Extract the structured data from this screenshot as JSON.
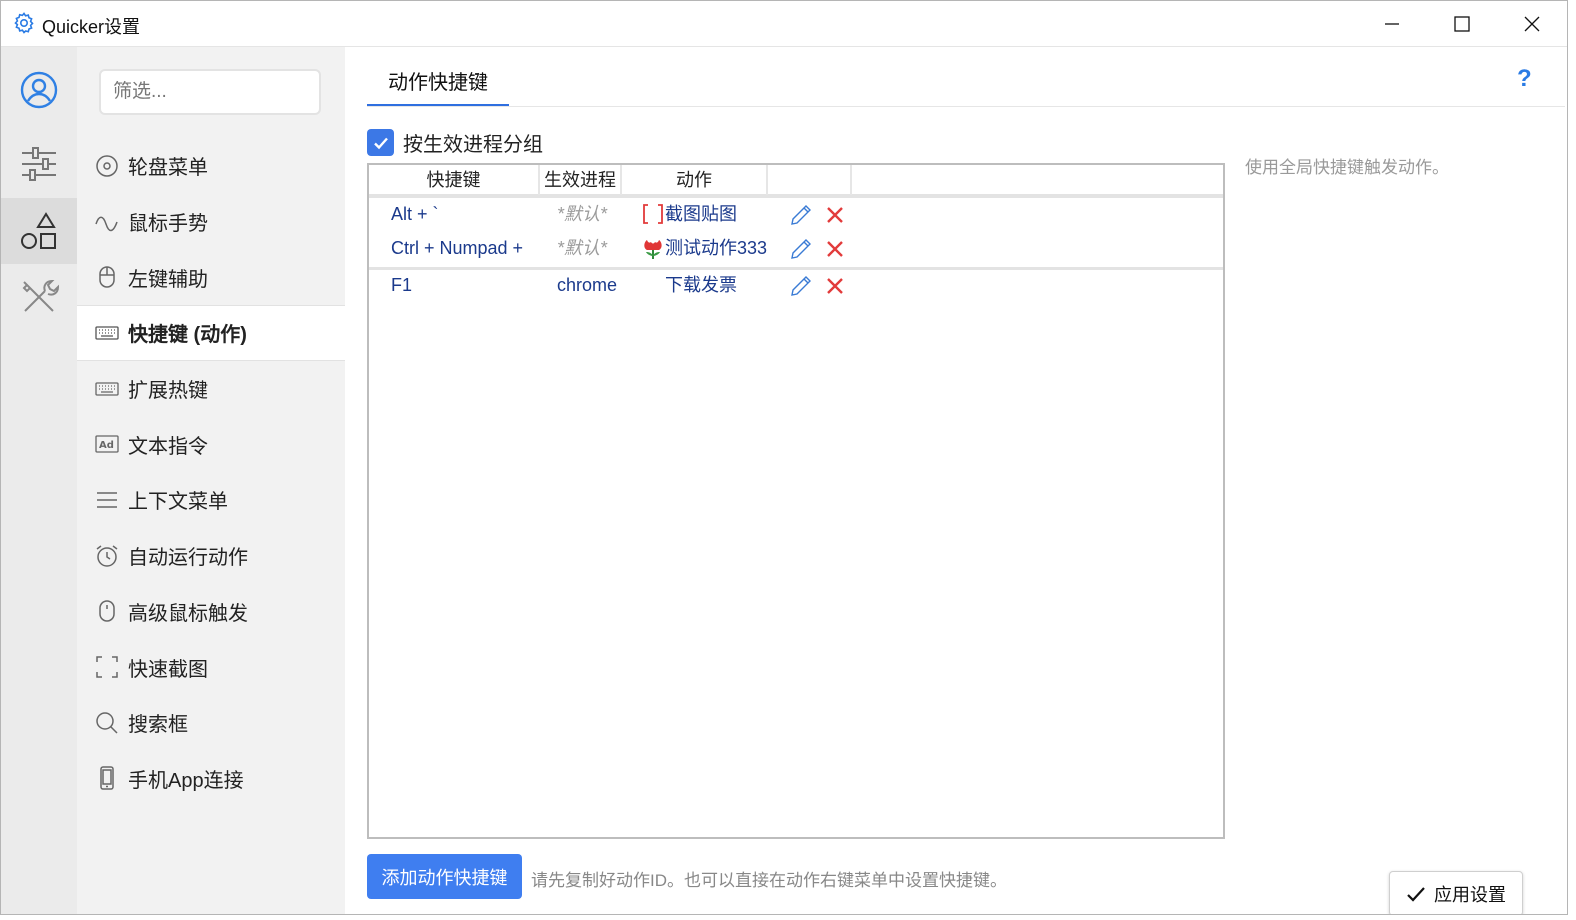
{
  "window": {
    "title": "Quicker设置"
  },
  "rail": {
    "items": [
      {
        "icon": "user-icon"
      },
      {
        "icon": "sliders-icon"
      },
      {
        "icon": "shapes-icon",
        "active": true
      },
      {
        "icon": "tools-icon"
      }
    ]
  },
  "nav": {
    "filter_placeholder": "筛选...",
    "items": [
      {
        "label": "轮盘菜单",
        "icon": "wheel-icon"
      },
      {
        "label": "鼠标手势",
        "icon": "gesture-icon"
      },
      {
        "label": "左键辅助",
        "icon": "mouse-icon"
      },
      {
        "label": "快捷键 (动作)",
        "icon": "keyboard-icon",
        "active": true
      },
      {
        "label": "扩展热键",
        "icon": "keyboard-icon"
      },
      {
        "label": "文本指令",
        "icon": "ad-icon"
      },
      {
        "label": "上下文菜单",
        "icon": "menu-lines-icon"
      },
      {
        "label": "自动运行动作",
        "icon": "alarm-icon"
      },
      {
        "label": "高级鼠标触发",
        "icon": "mouse-icon"
      },
      {
        "label": "快速截图",
        "icon": "screenshot-icon"
      },
      {
        "label": "搜索框",
        "icon": "search-icon"
      },
      {
        "label": "手机App连接",
        "icon": "phone-icon"
      }
    ]
  },
  "main": {
    "tab_label": "动作快捷键",
    "help_label": "?",
    "group_checkbox_label": "按生效进程分组",
    "group_checked": true,
    "side_hint": "使用全局快捷键触发动作。",
    "table": {
      "headers": [
        "快捷键",
        "生效进程",
        "动作"
      ],
      "rows": [
        {
          "key": "Alt + `",
          "process": "*默认*",
          "process_is_default": true,
          "action": "截图贴图",
          "action_icon": "bracket-screenshot-icon"
        },
        {
          "key": "Ctrl + Numpad +",
          "process": "*默认*",
          "process_is_default": true,
          "action": "测试动作333",
          "action_icon": "tulip-icon"
        },
        {
          "key": "F1",
          "process": "chrome",
          "process_is_default": false,
          "action": "下载发票",
          "action_icon": ""
        }
      ]
    },
    "add_button_label": "添加动作快捷键",
    "add_hint": "请先复制好动作ID。也可以直接在动作右键菜单中设置快捷键。",
    "apply_button_label": "应用设置"
  },
  "colors": {
    "accent": "#3f7ef0",
    "link_text": "#1b3a8c",
    "delete_red": "#e23b3b",
    "edit_blue": "#3a7bd5"
  }
}
